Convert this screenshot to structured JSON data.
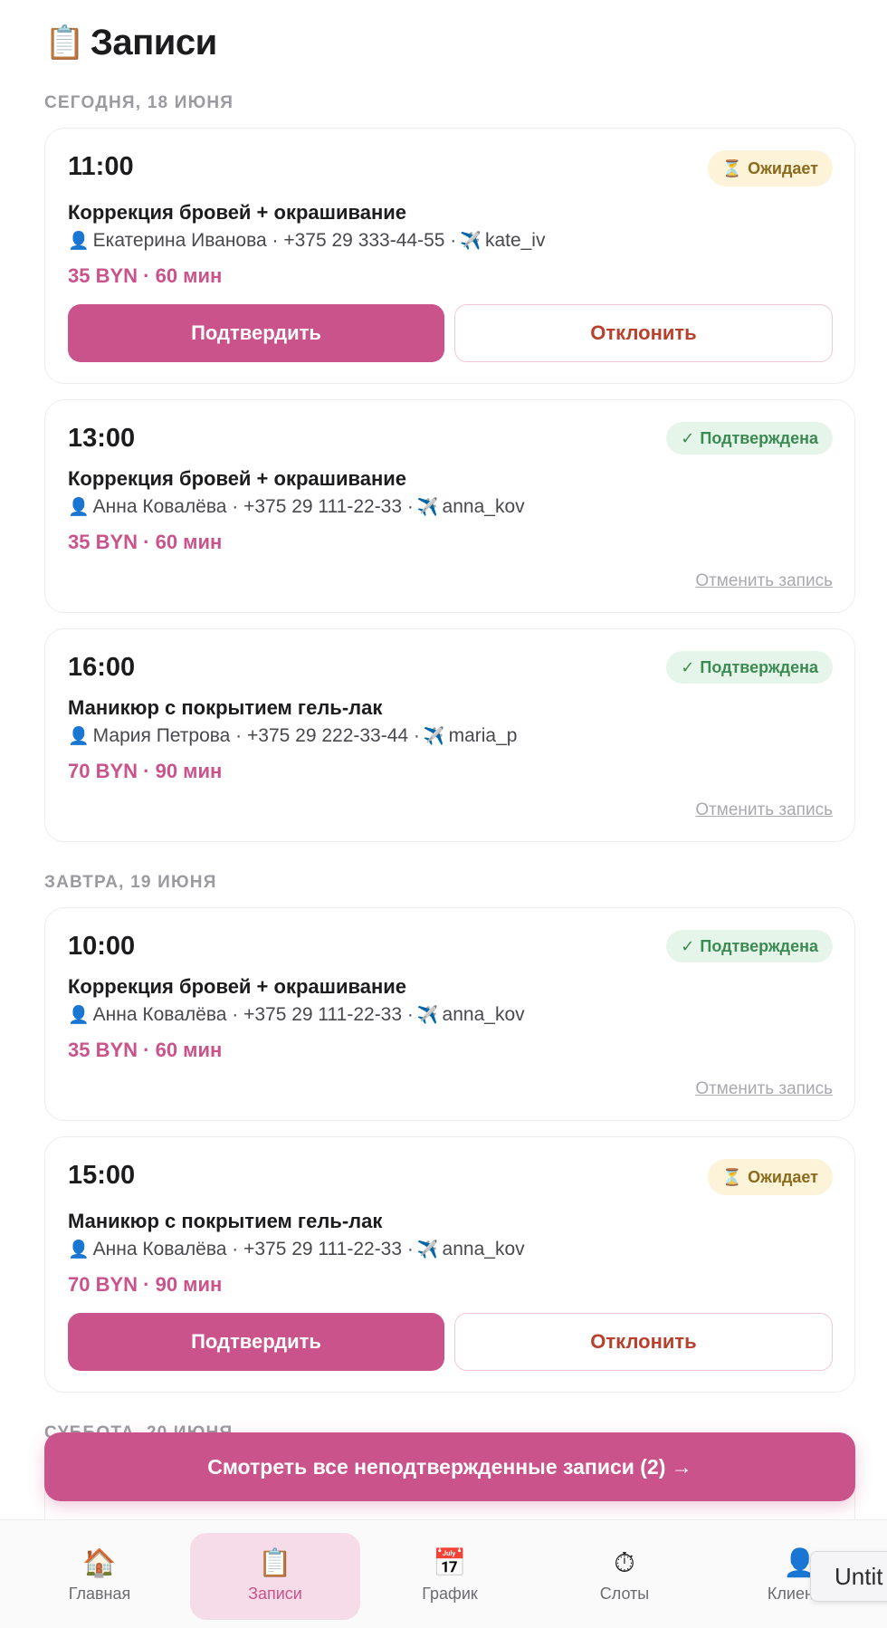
{
  "header": {
    "icon": "📋",
    "title": "Записи"
  },
  "sections": [
    {
      "label": "СЕГОДНЯ, 18 ИЮНЯ"
    },
    {
      "label": "ЗАВТРА, 19 ИЮНЯ"
    },
    {
      "label": "СУББОТА, 20 ИЮНЯ"
    }
  ],
  "appointments": [
    {
      "time": "11:00",
      "status": "Ожидает",
      "status_icon": "⏳",
      "service": "Коррекция бровей + окрашивание",
      "client": "Екатерина Иванова · +375 29 333-44-55 ·",
      "telegram": "kate_iv",
      "price": "35 BYN · 60 мин",
      "confirm_label": "Подтвердить",
      "reject_label": "Отклонить"
    },
    {
      "time": "13:00",
      "status": "Подтверждена",
      "status_icon": "✓",
      "service": "Коррекция бровей + окрашивание",
      "client": "Анна Ковалёва · +375 29 111-22-33 ·",
      "telegram": "anna_kov",
      "price": "35 BYN · 60 мин",
      "cancel_label": "Отменить запись"
    },
    {
      "time": "16:00",
      "status": "Подтверждена",
      "status_icon": "✓",
      "service": "Маникюр с покрытием гель-лак",
      "client": "Мария Петрова · +375 29 222-33-44 ·",
      "telegram": "maria_p",
      "price": "70 BYN · 90 мин",
      "cancel_label": "Отменить запись"
    },
    {
      "time": "10:00",
      "status": "Подтверждена",
      "status_icon": "✓",
      "service": "Коррекция бровей + окрашивание",
      "client": "Анна Ковалёва · +375 29 111-22-33 ·",
      "telegram": "anna_kov",
      "price": "35 BYN · 60 мин",
      "cancel_label": "Отменить запись"
    },
    {
      "time": "15:00",
      "status": "Ожидает",
      "status_icon": "⏳",
      "service": "Маникюр с покрытием гель-лак",
      "client": "Анна Ковалёва · +375 29 111-22-33 ·",
      "telegram": "anna_kov",
      "price": "70 BYN · 90 мин",
      "confirm_label": "Подтвердить",
      "reject_label": "Отклонить"
    }
  ],
  "fab": {
    "label": "Смотреть все неподтвержденные записи (2) →"
  },
  "nav": [
    {
      "label": "Главная",
      "icon": "🏠"
    },
    {
      "label": "Записи",
      "icon": "📋"
    },
    {
      "label": "График",
      "icon": "📅"
    },
    {
      "label": "Слоты",
      "icon": "⏱"
    },
    {
      "label": "Клиенты",
      "icon": "👤"
    }
  ],
  "overlay": {
    "label": "Untit"
  },
  "colors": {
    "accent": "#c9538a",
    "pending_bg": "#fcf3d8",
    "confirmed_bg": "#e6f5ea",
    "reject_text": "#b8412e"
  }
}
